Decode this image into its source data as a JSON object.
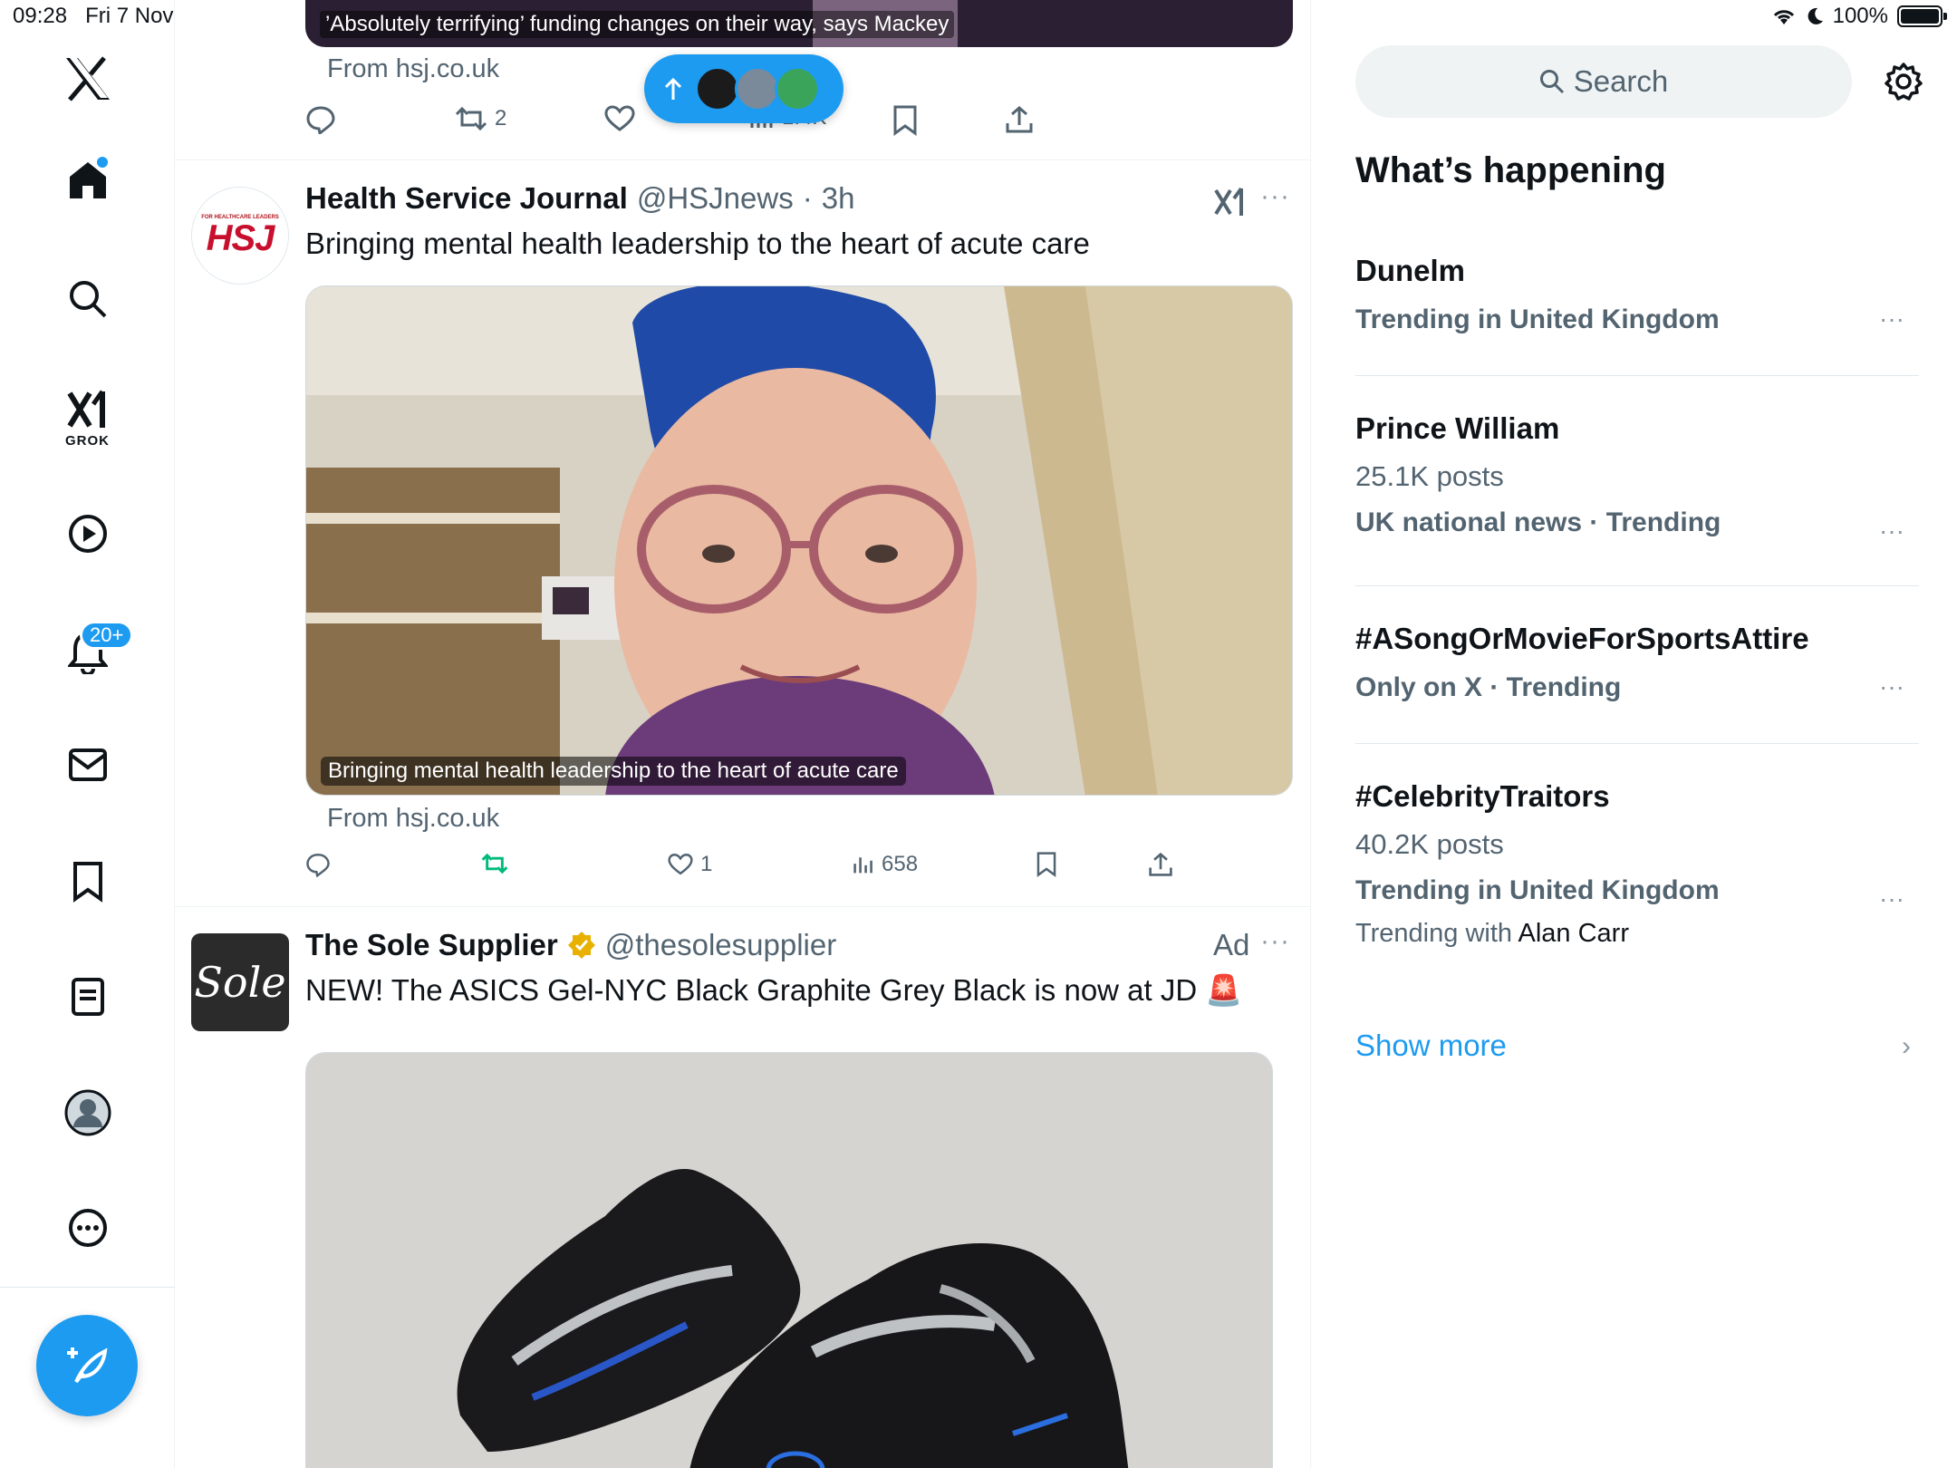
{
  "status_bar": {
    "time": "09:28",
    "date": "Fri 7 Nov",
    "battery": "100%"
  },
  "nav": {
    "grok_label": "GROK",
    "notifications_badge": "20+"
  },
  "timeline": {
    "top_post": {
      "media_caption": "’Absolutely terrifying’ funding changes on their way, says Mackey",
      "from": "From hsj.co.uk",
      "retweets": "2",
      "views": "1.4K"
    },
    "hsj_post": {
      "display_name": "Health Service Journal",
      "handle": "@HSJnews",
      "time": "3h",
      "text": "Bringing mental health leadership to the heart of acute care",
      "media_caption": "Bringing mental health leadership to the heart of acute care",
      "from": "From hsj.co.uk",
      "likes": "1",
      "views": "658",
      "avatar_small": "FOR HEALTHCARE LEADERS",
      "avatar_big": "HSJ"
    },
    "sole_post": {
      "display_name": "The Sole Supplier",
      "handle": "@thesolesupplier",
      "ad_label": "Ad",
      "text": "NEW! The ASICS Gel-NYC Black Graphite Grey Black is now at JD 🚨",
      "avatar_text": "Sole"
    }
  },
  "sidebar": {
    "search_placeholder": "Search",
    "section_title": "What’s happening",
    "trends": [
      {
        "name": "Dunelm",
        "meta": "Trending in United Kingdom"
      },
      {
        "name": "Prince William",
        "posts": "25.1K posts",
        "meta": "UK national news · Trending"
      },
      {
        "name": "#ASongOrMovieForSportsAttire",
        "meta": "Only on X · Trending"
      },
      {
        "name": "#CelebrityTraitors",
        "posts": "40.2K posts",
        "meta": "Trending in United Kingdom",
        "with_prefix": "Trending with",
        "with_name": "Alan Carr"
      }
    ],
    "show_more": "Show more"
  },
  "colors": {
    "accent": "#1d9bf0",
    "text": "#0f1419",
    "muted": "#536471",
    "retweet_green": "#00ba7c"
  }
}
